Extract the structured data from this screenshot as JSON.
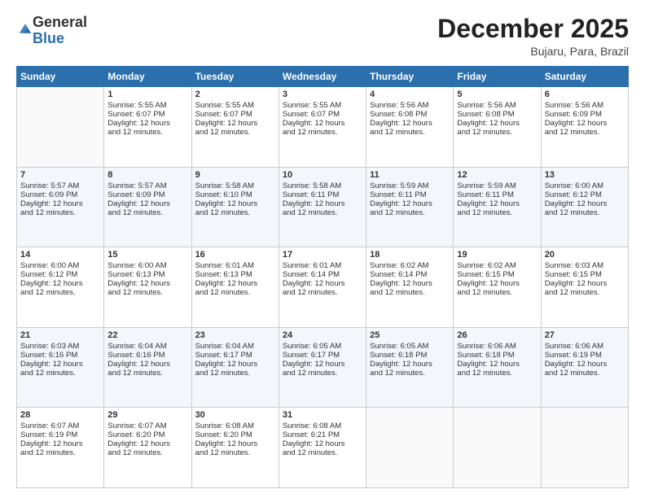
{
  "logo": {
    "general": "General",
    "blue": "Blue"
  },
  "header": {
    "month": "December 2025",
    "location": "Bujaru, Para, Brazil"
  },
  "weekdays": [
    "Sunday",
    "Monday",
    "Tuesday",
    "Wednesday",
    "Thursday",
    "Friday",
    "Saturday"
  ],
  "weeks": [
    [
      {
        "day": "",
        "lines": []
      },
      {
        "day": "1",
        "lines": [
          "Sunrise: 5:55 AM",
          "Sunset: 6:07 PM",
          "Daylight: 12 hours",
          "and 12 minutes."
        ]
      },
      {
        "day": "2",
        "lines": [
          "Sunrise: 5:55 AM",
          "Sunset: 6:07 PM",
          "Daylight: 12 hours",
          "and 12 minutes."
        ]
      },
      {
        "day": "3",
        "lines": [
          "Sunrise: 5:55 AM",
          "Sunset: 6:07 PM",
          "Daylight: 12 hours",
          "and 12 minutes."
        ]
      },
      {
        "day": "4",
        "lines": [
          "Sunrise: 5:56 AM",
          "Sunset: 6:08 PM",
          "Daylight: 12 hours",
          "and 12 minutes."
        ]
      },
      {
        "day": "5",
        "lines": [
          "Sunrise: 5:56 AM",
          "Sunset: 6:08 PM",
          "Daylight: 12 hours",
          "and 12 minutes."
        ]
      },
      {
        "day": "6",
        "lines": [
          "Sunrise: 5:56 AM",
          "Sunset: 6:09 PM",
          "Daylight: 12 hours",
          "and 12 minutes."
        ]
      }
    ],
    [
      {
        "day": "7",
        "lines": [
          "Sunrise: 5:57 AM",
          "Sunset: 6:09 PM",
          "Daylight: 12 hours",
          "and 12 minutes."
        ]
      },
      {
        "day": "8",
        "lines": [
          "Sunrise: 5:57 AM",
          "Sunset: 6:09 PM",
          "Daylight: 12 hours",
          "and 12 minutes."
        ]
      },
      {
        "day": "9",
        "lines": [
          "Sunrise: 5:58 AM",
          "Sunset: 6:10 PM",
          "Daylight: 12 hours",
          "and 12 minutes."
        ]
      },
      {
        "day": "10",
        "lines": [
          "Sunrise: 5:58 AM",
          "Sunset: 6:11 PM",
          "Daylight: 12 hours",
          "and 12 minutes."
        ]
      },
      {
        "day": "11",
        "lines": [
          "Sunrise: 5:59 AM",
          "Sunset: 6:11 PM",
          "Daylight: 12 hours",
          "and 12 minutes."
        ]
      },
      {
        "day": "12",
        "lines": [
          "Sunrise: 5:59 AM",
          "Sunset: 6:11 PM",
          "Daylight: 12 hours",
          "and 12 minutes."
        ]
      },
      {
        "day": "13",
        "lines": [
          "Sunrise: 6:00 AM",
          "Sunset: 6:12 PM",
          "Daylight: 12 hours",
          "and 12 minutes."
        ]
      }
    ],
    [
      {
        "day": "14",
        "lines": [
          "Sunrise: 6:00 AM",
          "Sunset: 6:12 PM",
          "Daylight: 12 hours",
          "and 12 minutes."
        ]
      },
      {
        "day": "15",
        "lines": [
          "Sunrise: 6:00 AM",
          "Sunset: 6:13 PM",
          "Daylight: 12 hours",
          "and 12 minutes."
        ]
      },
      {
        "day": "16",
        "lines": [
          "Sunrise: 6:01 AM",
          "Sunset: 6:13 PM",
          "Daylight: 12 hours",
          "and 12 minutes."
        ]
      },
      {
        "day": "17",
        "lines": [
          "Sunrise: 6:01 AM",
          "Sunset: 6:14 PM",
          "Daylight: 12 hours",
          "and 12 minutes."
        ]
      },
      {
        "day": "18",
        "lines": [
          "Sunrise: 6:02 AM",
          "Sunset: 6:14 PM",
          "Daylight: 12 hours",
          "and 12 minutes."
        ]
      },
      {
        "day": "19",
        "lines": [
          "Sunrise: 6:02 AM",
          "Sunset: 6:15 PM",
          "Daylight: 12 hours",
          "and 12 minutes."
        ]
      },
      {
        "day": "20",
        "lines": [
          "Sunrise: 6:03 AM",
          "Sunset: 6:15 PM",
          "Daylight: 12 hours",
          "and 12 minutes."
        ]
      }
    ],
    [
      {
        "day": "21",
        "lines": [
          "Sunrise: 6:03 AM",
          "Sunset: 6:16 PM",
          "Daylight: 12 hours",
          "and 12 minutes."
        ]
      },
      {
        "day": "22",
        "lines": [
          "Sunrise: 6:04 AM",
          "Sunset: 6:16 PM",
          "Daylight: 12 hours",
          "and 12 minutes."
        ]
      },
      {
        "day": "23",
        "lines": [
          "Sunrise: 6:04 AM",
          "Sunset: 6:17 PM",
          "Daylight: 12 hours",
          "and 12 minutes."
        ]
      },
      {
        "day": "24",
        "lines": [
          "Sunrise: 6:05 AM",
          "Sunset: 6:17 PM",
          "Daylight: 12 hours",
          "and 12 minutes."
        ]
      },
      {
        "day": "25",
        "lines": [
          "Sunrise: 6:05 AM",
          "Sunset: 6:18 PM",
          "Daylight: 12 hours",
          "and 12 minutes."
        ]
      },
      {
        "day": "26",
        "lines": [
          "Sunrise: 6:06 AM",
          "Sunset: 6:18 PM",
          "Daylight: 12 hours",
          "and 12 minutes."
        ]
      },
      {
        "day": "27",
        "lines": [
          "Sunrise: 6:06 AM",
          "Sunset: 6:19 PM",
          "Daylight: 12 hours",
          "and 12 minutes."
        ]
      }
    ],
    [
      {
        "day": "28",
        "lines": [
          "Sunrise: 6:07 AM",
          "Sunset: 6:19 PM",
          "Daylight: 12 hours",
          "and 12 minutes."
        ]
      },
      {
        "day": "29",
        "lines": [
          "Sunrise: 6:07 AM",
          "Sunset: 6:20 PM",
          "Daylight: 12 hours",
          "and 12 minutes."
        ]
      },
      {
        "day": "30",
        "lines": [
          "Sunrise: 6:08 AM",
          "Sunset: 6:20 PM",
          "Daylight: 12 hours",
          "and 12 minutes."
        ]
      },
      {
        "day": "31",
        "lines": [
          "Sunrise: 6:08 AM",
          "Sunset: 6:21 PM",
          "Daylight: 12 hours",
          "and 12 minutes."
        ]
      },
      {
        "day": "",
        "lines": []
      },
      {
        "day": "",
        "lines": []
      },
      {
        "day": "",
        "lines": []
      }
    ]
  ]
}
